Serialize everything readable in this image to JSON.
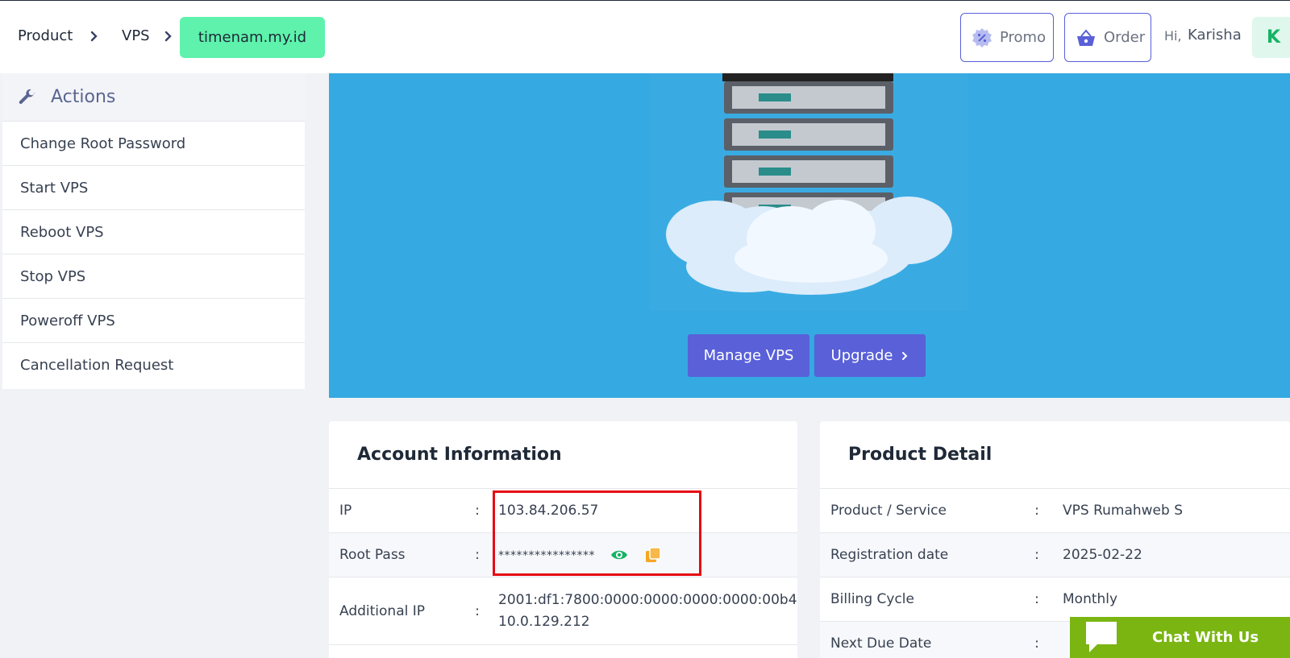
{
  "breadcrumb": {
    "items": [
      "Product",
      "VPS"
    ],
    "current": "timenam.my.id"
  },
  "header": {
    "promo_label": "Promo",
    "order_label": "Order",
    "greeting": "Hi,",
    "username": "Karisha",
    "avatar_initial": "K"
  },
  "actions": {
    "title": "Actions",
    "items": [
      "Change Root Password",
      "Start VPS",
      "Reboot VPS",
      "Stop VPS",
      "Poweroff VPS",
      "Cancellation Request"
    ]
  },
  "hero": {
    "manage_label": "Manage VPS",
    "upgrade_label": "Upgrade"
  },
  "account": {
    "title": "Account Information",
    "rows": [
      {
        "label": "IP",
        "sep": ":",
        "value": "103.84.206.57"
      },
      {
        "label": "Root Pass",
        "sep": ":",
        "value": "****************"
      },
      {
        "label": "Additional IP",
        "sep": ":",
        "value_lines": [
          "2001:df1:7800:0000:0000:0000:0000:00b4",
          "10.0.129.212"
        ]
      }
    ]
  },
  "product": {
    "title": "Product Detail",
    "rows": [
      {
        "label": "Product / Service",
        "sep": ":",
        "value": "VPS Rumahweb S"
      },
      {
        "label": "Registration date",
        "sep": ":",
        "value": "2025-02-22"
      },
      {
        "label": "Billing Cycle",
        "sep": ":",
        "value": "Monthly"
      },
      {
        "label": "Next Due Date",
        "sep": ":",
        "value": ""
      }
    ]
  },
  "chat": {
    "label": "Chat With Us"
  },
  "colors": {
    "accent": "#5960d8",
    "breadcrumb_active": "#5ef2ac",
    "hero_bg": "#35a9e1",
    "chat_bg": "#7ab512",
    "highlight": "#e50914"
  }
}
